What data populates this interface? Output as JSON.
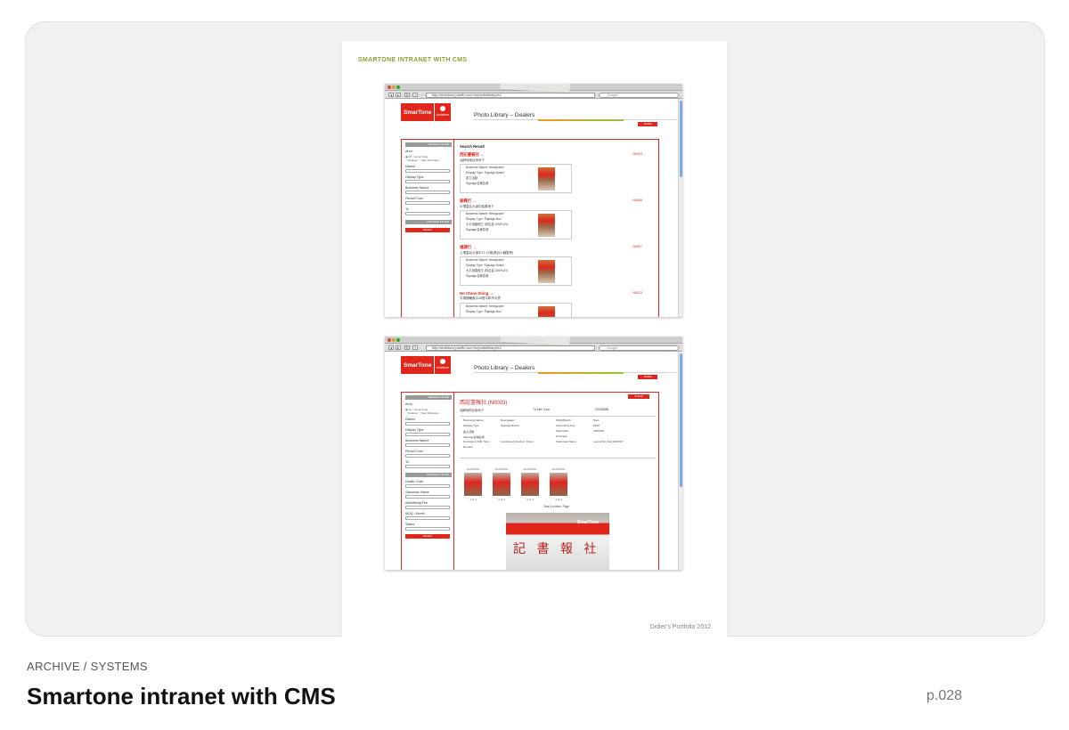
{
  "card": {
    "category": "ARCHIVE / SYSTEMS",
    "title": "Smartone intranet with CMS",
    "page_number": "p.028"
  },
  "scan": {
    "heading": "SMARTONE INTRANET WITH CMS",
    "footer": "Didier's Portfolio 2012"
  },
  "browser": {
    "window_title": "Smar•                                                                Search",
    "url": "http://smartone.pacific.com.hk/photolibrary/en/",
    "search_placeholder": "Google"
  },
  "site": {
    "logo_text": "SmarTone",
    "logo_partner": "vodafone",
    "page_title": "Photo Library – Dealers",
    "top_button": "SLIDE"
  },
  "sidebar": {
    "search_filter": "SEARCH FILTER",
    "area_label": "Area",
    "area_options": [
      "All",
      "Hong Kong",
      "Kowloon",
      "New Territories"
    ],
    "district_label": "District",
    "display_type_label": "Display Type",
    "business_nature_label": "Business Nature",
    "period_from_label": "Period From",
    "to_label": "To",
    "select_all": "All",
    "advance_filter": "ADVANCE FILTER",
    "dealer_code_label": "Dealer Code",
    "salesman_name_label": "Salesman Name",
    "advertising_fee_label": "Advertising Fee",
    "mcq_label": "MOQ / Month",
    "status_label": "Status",
    "reset": "RESET"
  },
  "results": {
    "heading": "Search Result",
    "entries": [
      {
        "name": "西記書報社 →",
        "id": "N0003",
        "address": "油麻地炮台街地下",
        "nature": "Business Nature: Newspaper",
        "display": "Display Type: Signage Board",
        "extra1": "設立活動",
        "extra2": "Signage名稱區域"
      },
      {
        "name": "泰興行 →",
        "id": "N0008",
        "address": "中環皇后大道中結果地下",
        "nature": "Business Nature: Newspaper",
        "display": "Display Type: Signage Box",
        "extra1": "大平用建程方 (特定盒 DISPLAY)",
        "extra2": "Signage名稱區域"
      },
      {
        "name": "福源行 →",
        "id": "N0007",
        "address": "上環皇后大道中71-21號(离谷小麵屋旁)",
        "nature": "Business Nature: Newspaper",
        "display": "Display Type: Signage Board",
        "extra1": "大平用建程方 (特定盒 DISPLAY)",
        "extra2": "Signage名稱區域"
      },
      {
        "name": "Ho Chow Shing →",
        "id": "N0013",
        "address": "中環德輔道中48號平和市大廈",
        "nature": "Business Nature: Newspaper",
        "display": "Display Type: Signage Box",
        "extra1": "",
        "extra2": ""
      }
    ]
  },
  "detail": {
    "title": "西記書報社 (N0003)",
    "tag": "SHOW",
    "address": "油麻地炮台街地下",
    "contact": "Tu Mei Chun",
    "phone": "23328888",
    "fields": [
      {
        "label": "Business Nature",
        "value": "Newspaper"
      },
      {
        "label": "Display Type",
        "value": "Signage Board"
      },
      {
        "label": "設立活動",
        "value": ""
      },
      {
        "label": "Signage名稱區域",
        "value": ""
      },
      {
        "label": "Consigned SIM: 5pcs",
        "value": "Consigned Voucher: 10pcs"
      },
      {
        "label": "Remark",
        "value": ""
      }
    ],
    "fields_right": [
      {
        "label": "MOQ/Month",
        "value": "5pcs"
      },
      {
        "label": "Advertising Fee",
        "value": "$100"
      },
      {
        "label": "Start Date",
        "value": "4/3/2004"
      },
      {
        "label": "End Date",
        "value": ""
      },
      {
        "label": "Salesman Name",
        "value": "Leung Shu Fai (S87047)"
      }
    ],
    "thumbs": [
      {
        "date": "14-03-2007",
        "index": "1 of 4"
      },
      {
        "date": "15-03-2007",
        "index": "2 of 4"
      },
      {
        "date": "09-03-2007",
        "index": "3 of 4"
      },
      {
        "date": "09-03-2007",
        "index": "4 of 4"
      }
    ],
    "total": "Total 4 photos, Page",
    "photo_taken": "Photo taken on: 19-03-2007",
    "photo_sign": "SmarTone",
    "photo_chars": "記 書 報 社"
  },
  "colors": {
    "brand_red": "#e1261c",
    "heading_green": "#8aa336"
  }
}
